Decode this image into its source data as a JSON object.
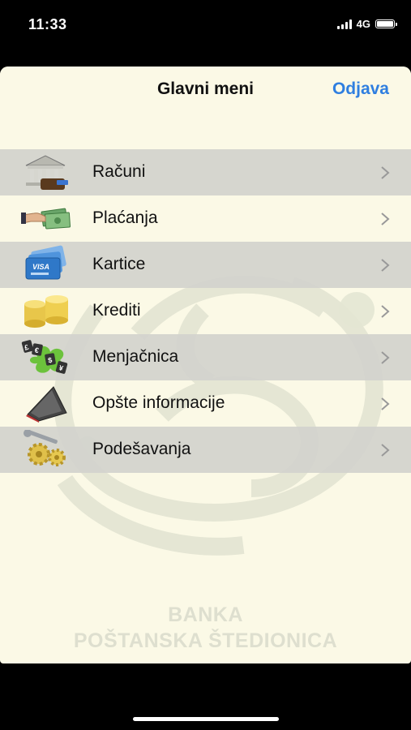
{
  "status": {
    "time": "11:33",
    "network": "4G"
  },
  "nav": {
    "title": "Glavni meni",
    "logout_label": "Odjava"
  },
  "menu": {
    "items": [
      {
        "label": "Računi",
        "icon": "bank-wallet-icon"
      },
      {
        "label": "Plaćanja",
        "icon": "hand-money-icon"
      },
      {
        "label": "Kartice",
        "icon": "credit-cards-icon"
      },
      {
        "label": " Krediti",
        "icon": "gold-coins-icon"
      },
      {
        "label": "Menjačnica",
        "icon": "currency-exchange-icon"
      },
      {
        "label": "Opšte informacije",
        "icon": "info-book-icon"
      },
      {
        "label": "Podešavanja",
        "icon": "gears-wrench-icon"
      }
    ]
  },
  "watermark": {
    "line1": "BANKA",
    "line2": "POŠTANSKA ŠTEDIONICA"
  },
  "colors": {
    "background": "#fbf9e6",
    "accent": "#2f7fe0",
    "row_shade": "#d2d2cd"
  }
}
